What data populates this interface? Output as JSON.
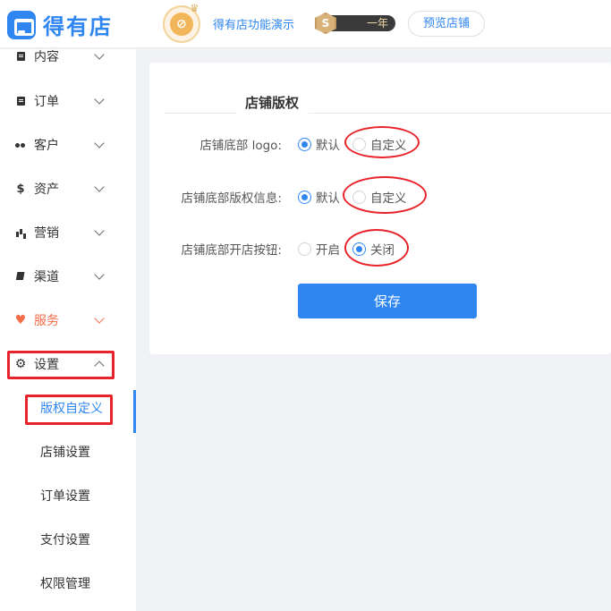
{
  "header": {
    "brand": "得有店",
    "store_name": "得有店功能演示",
    "vip_level": "S",
    "vip_term": "一年",
    "preview_button": "预览店铺"
  },
  "sidebar": {
    "items": [
      {
        "label": "内容",
        "icon": "document-icon"
      },
      {
        "label": "订单",
        "icon": "order-icon"
      },
      {
        "label": "客户",
        "icon": "users-icon"
      },
      {
        "label": "资产",
        "icon": "dollar-icon"
      },
      {
        "label": "营销",
        "icon": "bar-chart-icon"
      },
      {
        "label": "渠道",
        "icon": "layers-icon"
      },
      {
        "label": "服务",
        "icon": "heart-icon"
      },
      {
        "label": "设置",
        "icon": "gear-icon"
      }
    ],
    "settings_sub": [
      {
        "label": "版权自定义",
        "active": true
      },
      {
        "label": "店铺设置"
      },
      {
        "label": "订单设置"
      },
      {
        "label": "支付设置"
      },
      {
        "label": "权限管理"
      }
    ]
  },
  "main": {
    "section_title": "店铺版权",
    "fields": [
      {
        "label": "店铺底部 logo:",
        "options": [
          "默认",
          "自定义"
        ],
        "selected": "默认"
      },
      {
        "label": "店铺底部版权信息:",
        "options": [
          "默认",
          "自定义"
        ],
        "selected": "默认"
      },
      {
        "label": "店铺底部开店按钮:",
        "options": [
          "开启",
          "关闭"
        ],
        "selected": "关闭"
      }
    ],
    "save_button": "保存"
  },
  "colors": {
    "accent": "#2f86f0",
    "service": "#f56c4a",
    "highlight": "#e8232a"
  }
}
